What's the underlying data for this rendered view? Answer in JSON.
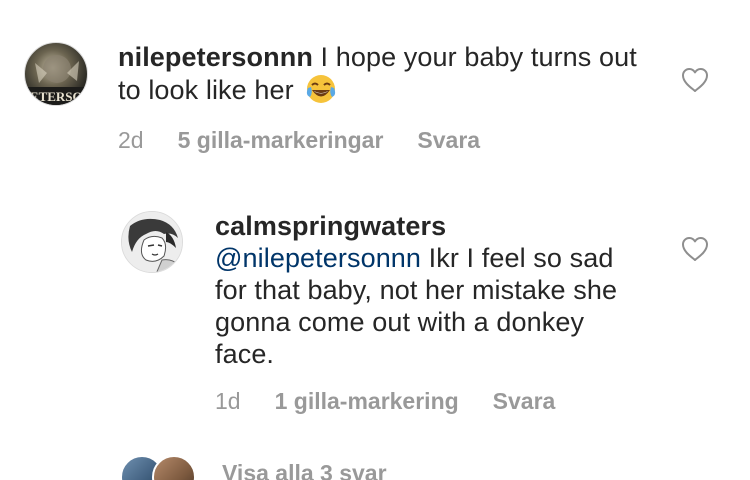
{
  "comments": [
    {
      "username": "nilepetersonnn",
      "text": "I hope your baby turns out to look like her",
      "emoji": "face-with-tears-of-joy-emoji",
      "time": "2d",
      "likes": "5 gilla-markeringar",
      "reply": "Svara",
      "avatar_text": "PETERSON"
    }
  ],
  "replies": [
    {
      "username": "calmspringwaters",
      "mention": "@nilepetersonnn",
      "text": "Ikr I feel so sad for that baby, not her mistake she gonna come out with a donkey face.",
      "time": "1d",
      "likes": "1 gilla-markering",
      "reply": "Svara"
    }
  ],
  "view_replies": {
    "label": "Visa alla 3 svar"
  },
  "colors": {
    "text": "#262626",
    "meta": "#999999",
    "mention": "#003569",
    "background": "#ffffff"
  }
}
